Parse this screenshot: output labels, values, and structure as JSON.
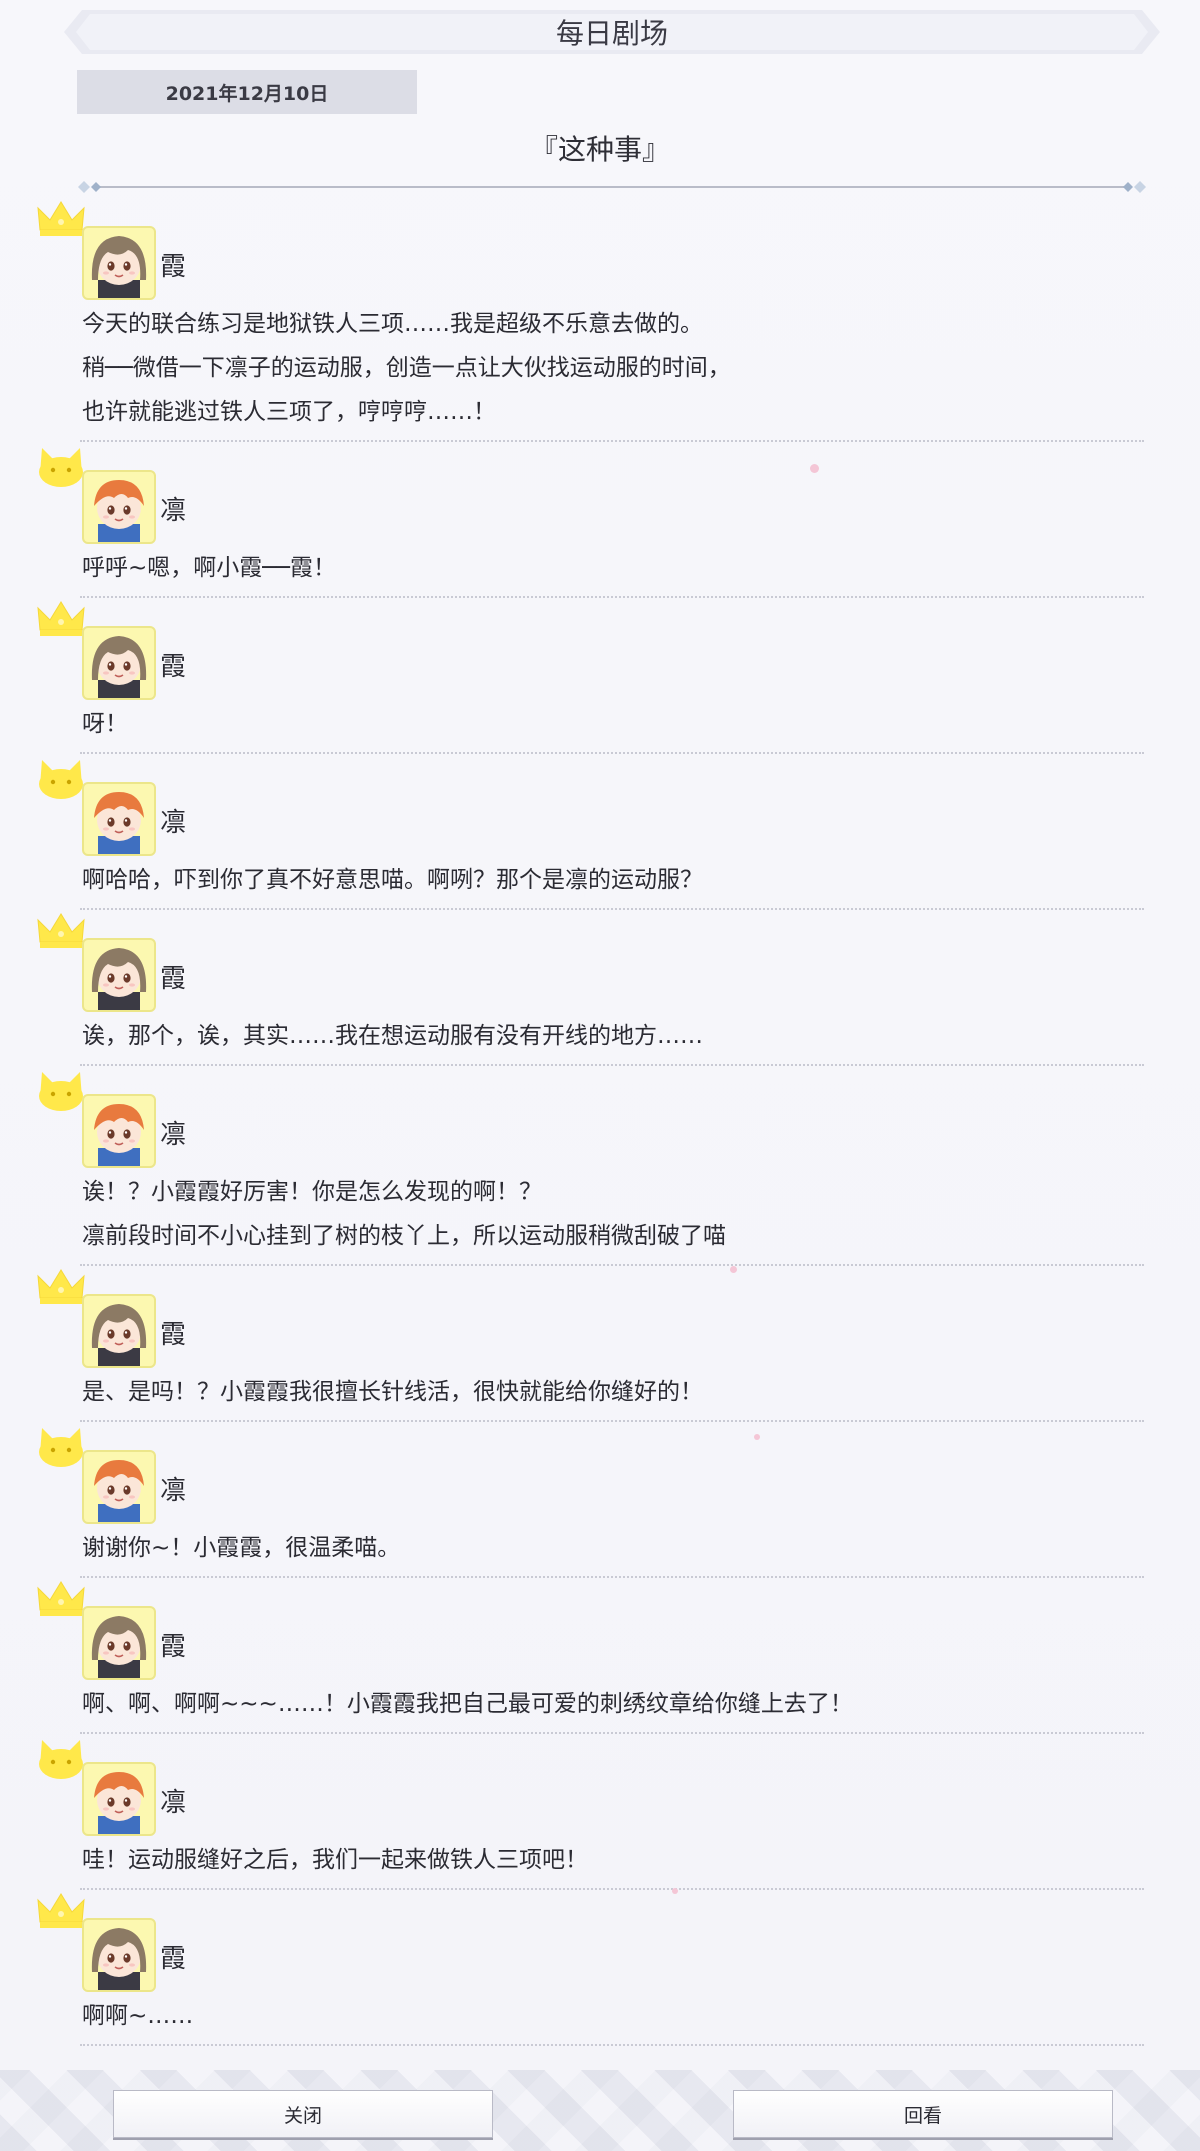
{
  "header": {
    "title": "每日剧场",
    "date": "2021年12月10日",
    "episode_title": "『这种事』"
  },
  "characters": {
    "kasumi": {
      "name": "霞",
      "badge": "crown-icon",
      "hair": "#8c7a64",
      "skin": "#fbe6d8",
      "uniform": "#3b3a44"
    },
    "rin": {
      "name": "凛",
      "badge": "cat-icon",
      "hair": "#e87a3e",
      "skin": "#fbe6d8",
      "uniform": "#3f6fc0"
    }
  },
  "dialogue": [
    {
      "speaker": "霞",
      "char": "kasumi",
      "lines": [
        "今天的联合练习是地狱铁人三项……我是超级不乐意去做的。",
        "稍──微借一下凛子的运动服，创造一点让大伙找运动服的时间，",
        "也许就能逃过铁人三项了，哼哼哼……！"
      ]
    },
    {
      "speaker": "凛",
      "char": "rin",
      "lines": [
        "呼呼~嗯，啊小霞──霞！"
      ]
    },
    {
      "speaker": "霞",
      "char": "kasumi",
      "lines": [
        "呀！"
      ]
    },
    {
      "speaker": "凛",
      "char": "rin",
      "lines": [
        "啊哈哈，吓到你了真不好意思喵。啊咧？那个是凛的运动服？"
      ]
    },
    {
      "speaker": "霞",
      "char": "kasumi",
      "lines": [
        "诶，那个，诶，其实……我在想运动服有没有开线的地方……"
      ]
    },
    {
      "speaker": "凛",
      "char": "rin",
      "lines": [
        "诶！？小霞霞好厉害！你是怎么发现的啊！？",
        "凛前段时间不小心挂到了树的枝丫上，所以运动服稍微刮破了喵"
      ]
    },
    {
      "speaker": "霞",
      "char": "kasumi",
      "lines": [
        "是、是吗！？小霞霞我很擅长针线活，很快就能给你缝好的！"
      ]
    },
    {
      "speaker": "凛",
      "char": "rin",
      "lines": [
        "谢谢你~！小霞霞，很温柔喵。"
      ]
    },
    {
      "speaker": "霞",
      "char": "kasumi",
      "lines": [
        "啊、啊、啊啊~~~……！小霞霞我把自己最可爱的刺绣纹章给你缝上去了！"
      ]
    },
    {
      "speaker": "凛",
      "char": "rin",
      "lines": [
        "哇！运动服缝好之后，我们一起来做铁人三项吧！"
      ]
    },
    {
      "speaker": "霞",
      "char": "kasumi",
      "lines": [
        "啊啊~……"
      ]
    }
  ],
  "buttons": {
    "close": "关闭",
    "replay": "回看"
  },
  "colors": {
    "badge_yellow": "#ffe84a",
    "avatar_bg": "#fcf8b0",
    "separator": "#c9cad4",
    "date_tag_bg": "#dcdde6"
  }
}
